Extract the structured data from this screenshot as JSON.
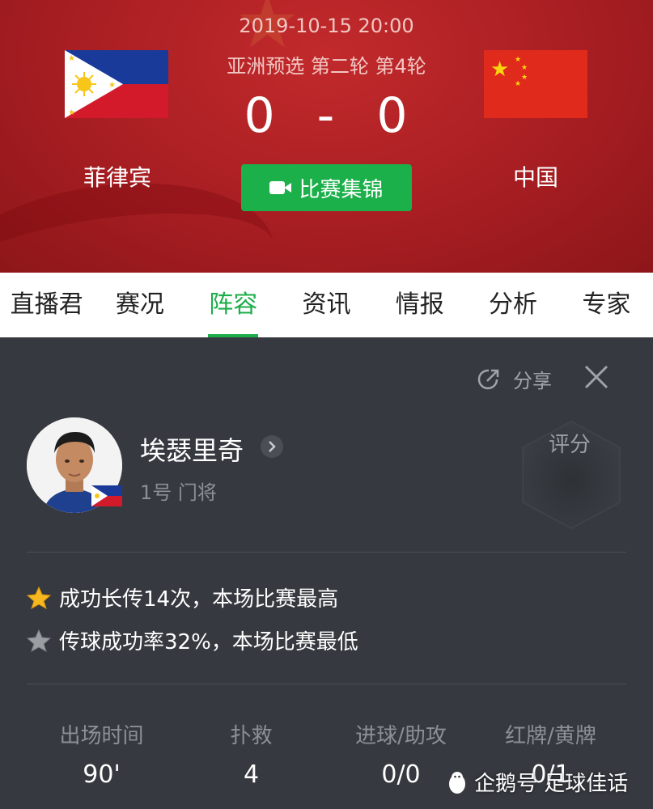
{
  "match": {
    "datetime": "2019-10-15 20:00",
    "round": "亚洲预选 第二轮 第4轮",
    "home_team": "菲律宾",
    "away_team": "中国",
    "home_score": "0",
    "separator": "-",
    "away_score": "0",
    "highlights_label": "比赛集锦"
  },
  "tabs": [
    {
      "label": "直播君"
    },
    {
      "label": "赛况"
    },
    {
      "label": "阵容",
      "active": true
    },
    {
      "label": "资讯"
    },
    {
      "label": "情报"
    },
    {
      "label": "分析"
    },
    {
      "label": "专家"
    }
  ],
  "panel": {
    "share_label": "分享",
    "player_name": "埃瑟里奇",
    "player_role": "1号 门将",
    "rating_label": "评分",
    "highlights": [
      {
        "icon": "gold-star-icon",
        "text": "成功长传14次，本场比赛最高"
      },
      {
        "icon": "gray-star-icon",
        "text": "传球成功率32%，本场比赛最低"
      }
    ],
    "stats": [
      {
        "label": "出场时间",
        "value": "90'"
      },
      {
        "label": "扑救",
        "value": "4"
      },
      {
        "label": "进球/助攻",
        "value": "0/0"
      },
      {
        "label": "红牌/黄牌",
        "value": "0/1"
      }
    ]
  },
  "watermark": "企鹅号 足球佳话",
  "colors": {
    "header_red": "#a81e22",
    "accent_green": "#1cae4a",
    "panel_bg": "#36393f"
  }
}
